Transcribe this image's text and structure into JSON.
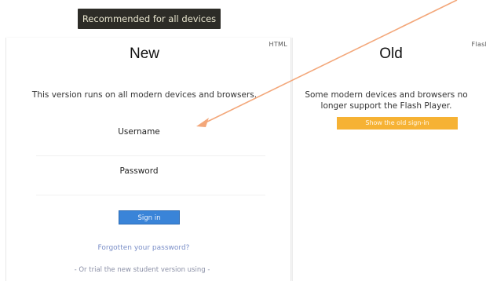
{
  "banner": {
    "label": "Recommended for all devices"
  },
  "new_panel": {
    "tag": "HTML",
    "title": "New",
    "description": "This version runs on all modern devices and browsers.",
    "username_label": "Username",
    "password_label": "Password",
    "signin_label": "Sign in",
    "forgot_label": "Forgotten your password?",
    "trial_label": "- Or trial the new student version using -"
  },
  "old_panel": {
    "tag": "Flash",
    "title": "Old",
    "description_line1": "Some modern devices and browsers no",
    "description_line2": "longer support the Flash Player.",
    "signin_label": "Show the old sign-in"
  },
  "colors": {
    "banner_bg": "#2d2c27",
    "signin_blue": "#3a84d8",
    "old_signin_orange": "#f6b234",
    "arrow": "#f3a77a"
  }
}
